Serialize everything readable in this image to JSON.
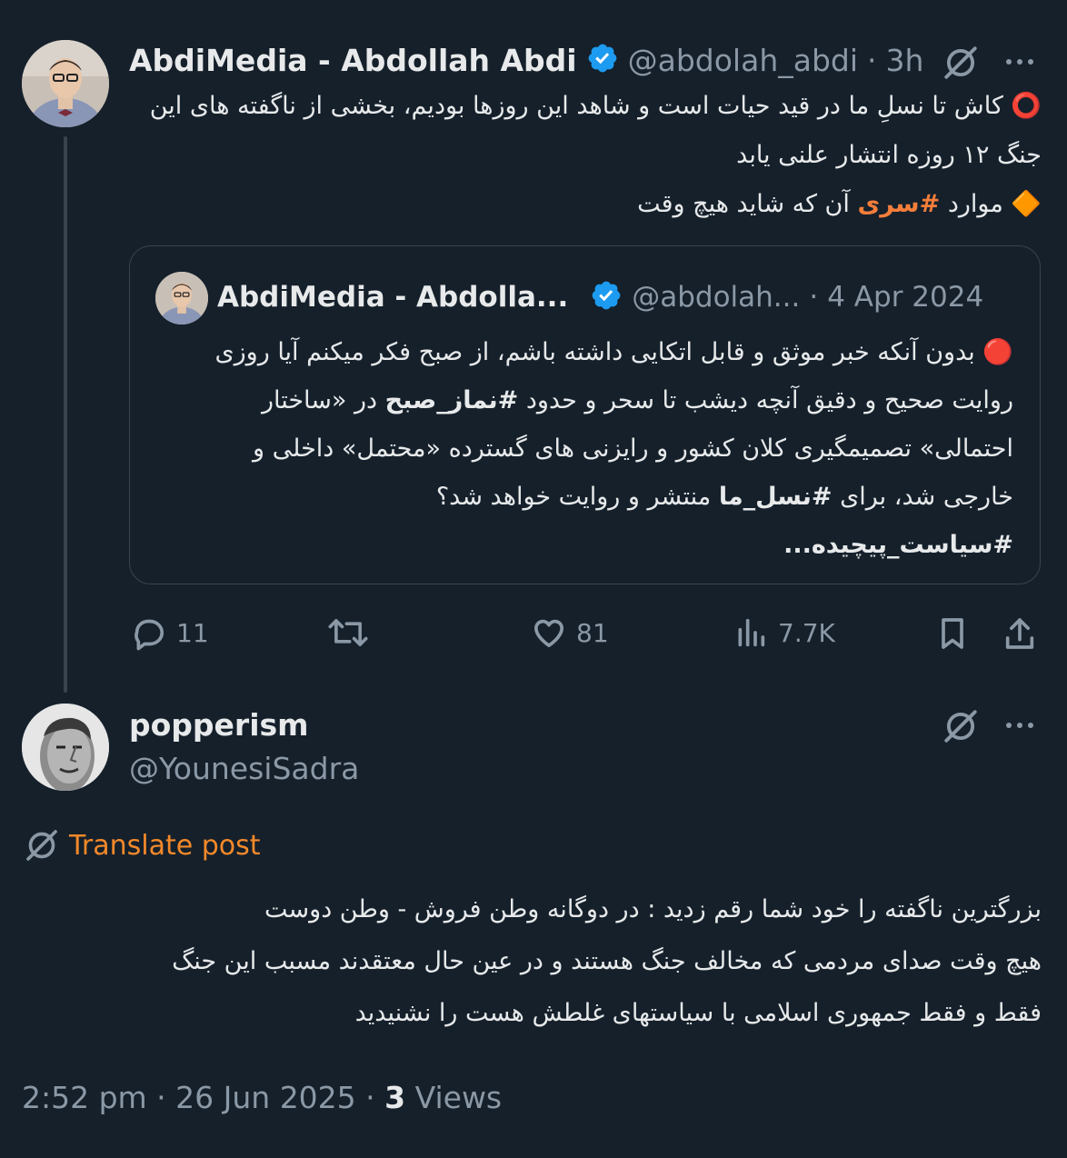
{
  "parent_tweet": {
    "display_name": "AbdiMedia - Abdollah Abdi",
    "handle": "@abdolah_abdi",
    "separator": "·",
    "time": "3h",
    "line1": "⭕️ کاش تا نسلِ ما در قید حیات است و شاهد این روزها بودیم، بخشی از ناگفته های این",
    "line2": "جنگ ۱۲ روزه انتشار علنی یابد",
    "line3_prefix": "🔶 موارد",
    "line3_hashtag": "#سری",
    "line3_suffix": "آن که شاید هیچ وقت",
    "quote": {
      "display_name": "AbdiMedia - Abdolla...",
      "handle": "@abdolah...",
      "separator": "·",
      "date": "4 Apr 2024",
      "line1": "🔴 بدون آنکه خبر موثق و قابل اتکایی داشته باشم، از صبح فکر میکنم آیا روزی",
      "line2_a": "روایت صحیح و دقیق آنچه دیشب تا سحر و حدود",
      "line2_hashtag": "#نماز_صبح",
      "line2_b": "در «ساختار",
      "line3": "احتمالی» تصمیمگیری کلان کشور و رایزنی های گسترده «محتمل» داخلی و",
      "line4_a": "خارجی شد، برای",
      "line4_hashtag": "#نسل_ما",
      "line4_b": "منتشر و روایت خواهد شد؟",
      "line5": "#سیاست_پیچیده..."
    },
    "actions": {
      "replies": "11",
      "likes": "81",
      "views": "7.7K"
    }
  },
  "reply_tweet": {
    "display_name": "popperism",
    "handle": "@YounesiSadra",
    "translate_label": "Translate post",
    "line1": "بزرگترین ناگفته را خود شما رقم زدید : در دوگانه وطن فروش - وطن دوست",
    "line2": "هیچ وقت صدای مردمی که مخالف جنگ هستند و در عین حال معتقدند مسبب این جنگ",
    "line3": "فقط و فقط جمهوری اسلامی با سیاستهای غلطش هست را نشنیدید",
    "timestamp": "2:52 pm · 26 Jun 2025 ·",
    "views_count": "3",
    "views_label": "Views"
  },
  "colors": {
    "background": "#15202b",
    "text": "#e7e9ea",
    "muted": "#8b98a5",
    "verified": "#1d9bf0",
    "translate": "#f4892a",
    "hashtag_highlight": "#f47e3a",
    "border": "#38444d"
  },
  "icons": [
    "verified-badge-icon",
    "grok-icon",
    "more-icon",
    "reply-icon",
    "retweet-icon",
    "like-icon",
    "views-icon",
    "bookmark-icon",
    "share-icon",
    "translate-globe-icon"
  ]
}
